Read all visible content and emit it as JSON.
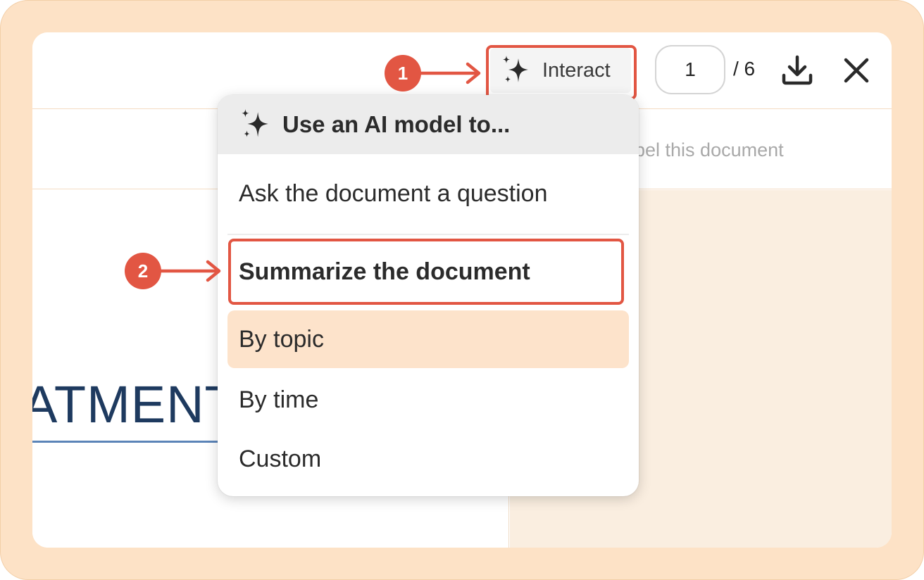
{
  "toolbar": {
    "interact_label": "Interact",
    "page_current": "1",
    "page_total": "/ 6"
  },
  "subbar": {
    "label_hint": "bel this document"
  },
  "document": {
    "heading_fragment": "ATMENT"
  },
  "menu": {
    "header": "Use an AI model to...",
    "items": [
      {
        "label": "Ask the document a question"
      },
      {
        "label": "Summarize the document"
      },
      {
        "label": "By topic"
      },
      {
        "label": "By time"
      },
      {
        "label": "Custom"
      }
    ]
  },
  "callouts": {
    "step1": "1",
    "step2": "2"
  },
  "colors": {
    "accent": "#e25643",
    "highlight": "#fde3cb",
    "frame": "#fde2c6"
  },
  "icons": {
    "interact": "sparkles-icon",
    "download": "download-icon",
    "close": "close-icon"
  }
}
